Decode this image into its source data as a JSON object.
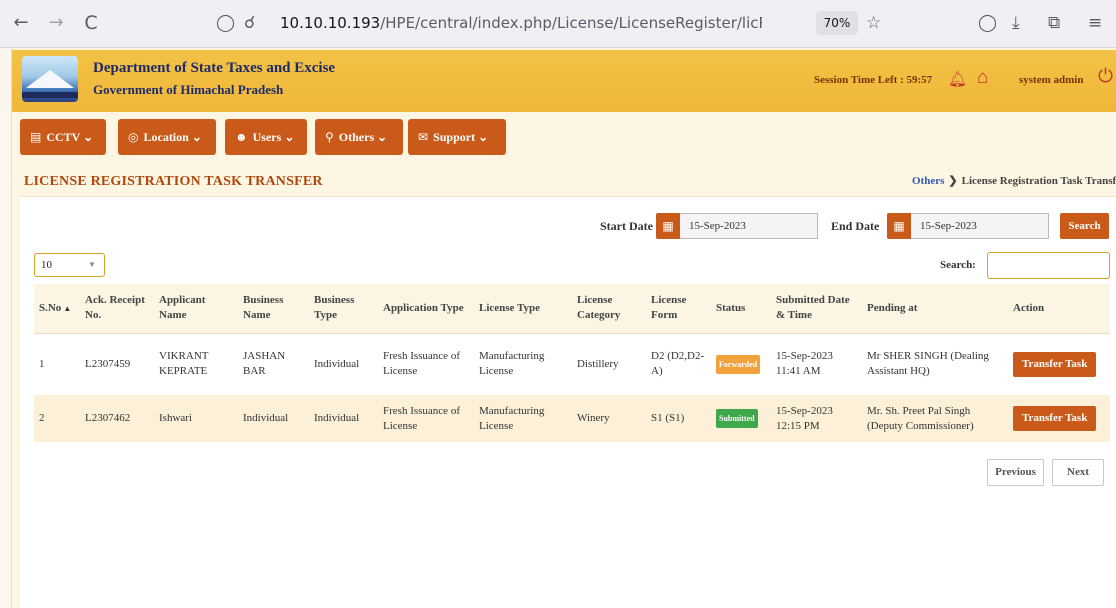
{
  "browser": {
    "back": "←",
    "forward": "→",
    "reload": "C",
    "url_host": "10.10.10.193",
    "url_path": "/HPE/central/index.php/License/LicenseRegister/licRegisterTaskTra",
    "zoom": "70%"
  },
  "header": {
    "title": "Department of State Taxes and Excise",
    "subtitle": "Government of Himachal Pradesh",
    "session": "Session Time Left : 59:57",
    "user": "system admin"
  },
  "menu": [
    {
      "label": "CCTV",
      "icon": "cctv-icon"
    },
    {
      "label": "Location",
      "icon": "location-icon"
    },
    {
      "label": "Users",
      "icon": "users-icon"
    },
    {
      "label": "Others",
      "icon": "search-icon"
    },
    {
      "label": "Support",
      "icon": "support-icon"
    }
  ],
  "page": {
    "title": "LICENSE REGISTRATION TASK TRANSFER",
    "breadcrumb_link": "Others",
    "breadcrumb_current": "License Registration Task Transf"
  },
  "filters": {
    "start_label": "Start Date",
    "start_value": "15-Sep-2023",
    "end_label": "End Date",
    "end_value": "15-Sep-2023",
    "search_button": "Search",
    "page_length": "10",
    "search_label": "Search:",
    "search_value": ""
  },
  "table": {
    "columns": [
      "S.No",
      "Ack. Receipt No.",
      "Applicant Name",
      "Business Name",
      "Business Type",
      "Application Type",
      "License Type",
      "License Category",
      "License Form",
      "Status",
      "Submitted Date & Time",
      "Pending at",
      "Action"
    ],
    "rows": [
      {
        "sno": "1",
        "ack": "L2307459",
        "applicant": "VIKRANT KEPRATE",
        "business": "JASHAN BAR",
        "btype": "Individual",
        "apptype": "Fresh Issuance of License",
        "ltype": "Manufacturing License",
        "lcat": "Distillery",
        "lform": "D2 (D2,D2-A)",
        "status": "Forwarded",
        "submitted": "15-Sep-2023 11:41 AM",
        "pending": "Mr SHER SINGH (Dealing Assistant HQ)",
        "action": "Transfer Task"
      },
      {
        "sno": "2",
        "ack": "L2307462",
        "applicant": "Ishwari",
        "business": "Individual",
        "btype": "Individual",
        "apptype": "Fresh Issuance of License",
        "ltype": "Manufacturing License",
        "lcat": "Winery",
        "lform": "S1 (S1)",
        "status": "Submitted",
        "submitted": "15-Sep-2023 12:15 PM",
        "pending": "Mr. Sh. Preet Pal Singh (Deputy Commissioner)",
        "action": "Transfer Task"
      }
    ]
  },
  "pagination": {
    "previous": "Previous",
    "next": "Next"
  },
  "colors": {
    "accent": "#c95a1a",
    "header": "#efb73a",
    "forwarded": "#f0a33a",
    "submitted": "#3fa84a"
  }
}
